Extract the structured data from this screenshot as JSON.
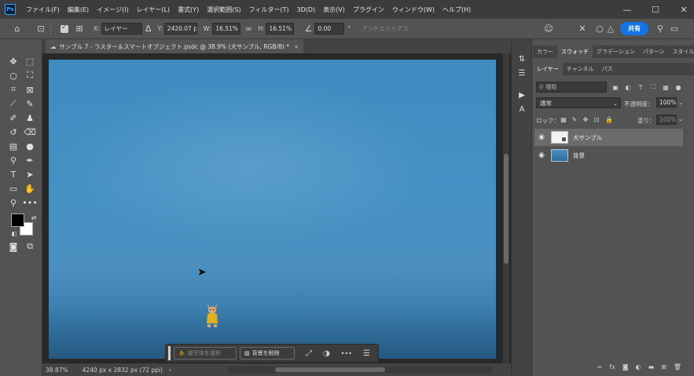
{
  "menubar": {
    "logo": "Ps",
    "items": [
      "ファイル(F)",
      "編集(E)",
      "イメージ(I)",
      "レイヤー(L)",
      "書式(Y)",
      "選択範囲(S)",
      "フィルター(T)",
      "3D(D)",
      "表示(V)",
      "プラグイン",
      "ウィンドウ(W)",
      "ヘルプ(H)"
    ],
    "window_controls": [
      "—",
      "☐",
      "✕"
    ]
  },
  "options": {
    "x_label": "X:",
    "x_value": "レイヤー",
    "y_label": "Y:",
    "y_value": "2420.07 px",
    "w_label": "W:",
    "w_value": "16.51%",
    "h_label": "H:",
    "h_value": "16.51%",
    "angle_value": "0.00",
    "angle_unit": "°",
    "antialias_label": "アンチエイリアス",
    "share_label": "共有"
  },
  "document": {
    "tab_title": "サンプル 7 - ラスター＆スマートオブジェクト.psdc @ 38.9% (犬サンプル, RGB/8) *",
    "tab_close": "×"
  },
  "status": {
    "zoom": "38.87%",
    "dimensions": "4240 px x 2832 px (72 ppi)",
    "arrow": "›"
  },
  "contextual_bar": {
    "select_subject": "被写体を選択",
    "remove_background": "背景を削除",
    "more": "•••"
  },
  "panel": {
    "tabs_top": [
      "カラー",
      "スウォッチ",
      "グラデーション",
      "パターン",
      "スタイル"
    ],
    "active_top_tab": "スウォッチ",
    "tabs_layers": [
      "レイヤー",
      "チャンネル",
      "パス"
    ],
    "active_layers_tab": "レイヤー",
    "search_placeholder": "種類",
    "blend_mode": "通常",
    "opacity_label": "不透明度：",
    "opacity_value": "100%",
    "lock_label": "ロック：",
    "fill_label": "塗り：",
    "fill_value": "100%",
    "layers": [
      {
        "name": "犬サンプル",
        "selected": true,
        "visible": true
      },
      {
        "name": "背景",
        "selected": false,
        "visible": true
      }
    ]
  },
  "colors": {
    "foreground": "#000000",
    "background": "#ffffff",
    "accent": "#1473e6"
  }
}
